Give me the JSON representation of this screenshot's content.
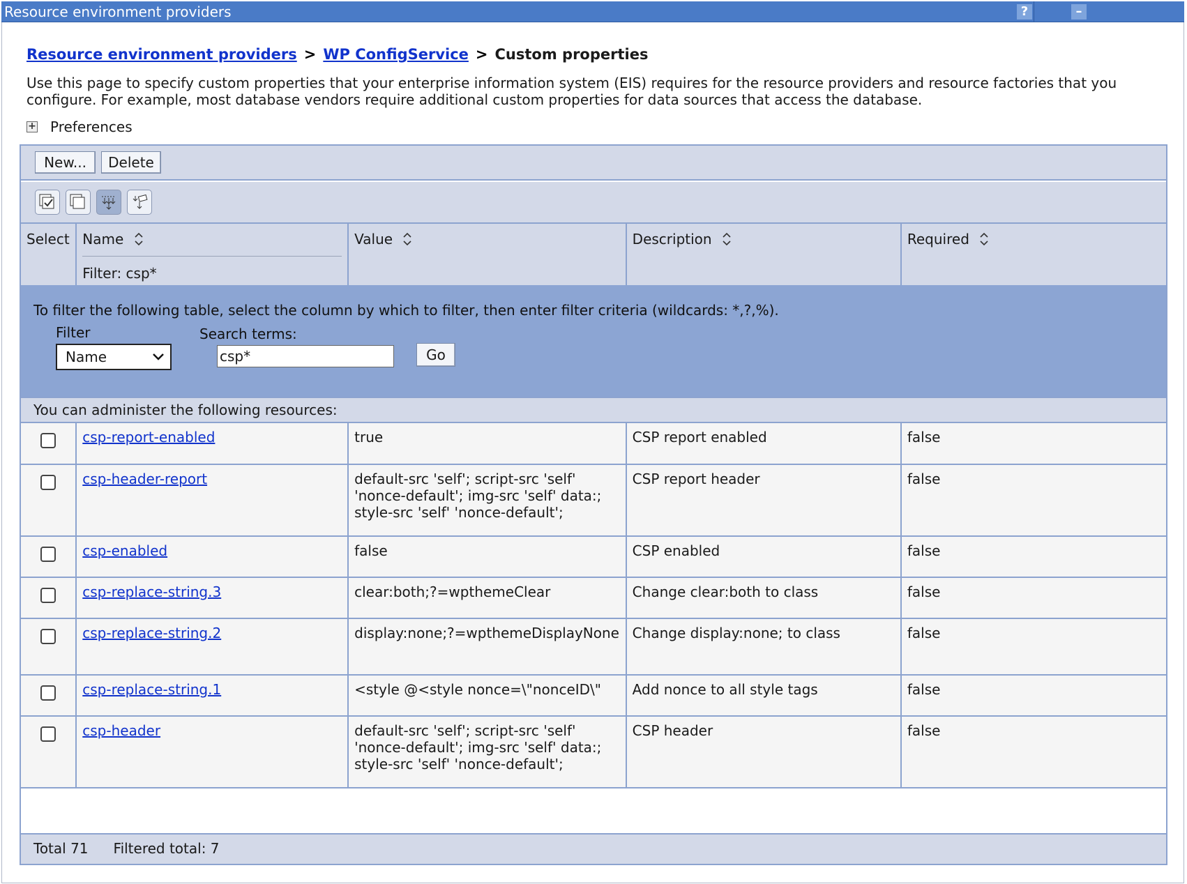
{
  "window": {
    "title": "Resource environment providers",
    "help_icon": "question-icon",
    "minimize_icon": "minimize-icon"
  },
  "breadcrumb": {
    "link1": "Resource environment providers",
    "separator": ">",
    "link2": "WP ConfigService",
    "current": "Custom properties"
  },
  "description": "Use this page to specify custom properties that your enterprise information system (EIS) requires for the resource providers and resource factories that you configure. For example, most database vendors require additional custom properties for data sources that access the database.",
  "preferences": {
    "label": "Preferences",
    "icon": "expand-plus-icon"
  },
  "toolbar": {
    "new_label": "New...",
    "delete_label": "Delete",
    "icons": [
      "select-all-icon",
      "deselect-all-icon",
      "show-filter-icon",
      "clear-filter-icon"
    ]
  },
  "table": {
    "columns": {
      "select": "Select",
      "name": "Name",
      "value": "Value",
      "description": "Description",
      "required": "Required"
    },
    "active_filter": "Filter: csp*",
    "rows": [
      {
        "name": "csp-report-enabled",
        "value": "true",
        "description": "CSP report enabled",
        "required": "false"
      },
      {
        "name": "csp-header-report",
        "value": "default-src 'self'; script-src 'self' 'nonce-default'; img-src 'self' data:; style-src 'self' 'nonce-default';",
        "description": "CSP report header",
        "required": "false"
      },
      {
        "name": "csp-enabled",
        "value": "false",
        "description": "CSP enabled",
        "required": "false"
      },
      {
        "name": "csp-replace-string.3",
        "value": "clear:both;?=wpthemeClear",
        "description": "Change clear:both to class",
        "required": "false"
      },
      {
        "name": "csp-replace-string.2",
        "value": "display:none;?=wpthemeDisplayNone",
        "description": "Change display:none; to class",
        "required": "false"
      },
      {
        "name": "csp-replace-string.1",
        "value": "<style @<style nonce=\\\"nonceID\\\"",
        "description": "Add nonce to all style tags",
        "required": "false"
      },
      {
        "name": "csp-header",
        "value": "default-src 'self'; script-src 'self' 'nonce-default'; img-src 'self' data:; style-src 'self' 'nonce-default';",
        "description": "CSP header",
        "required": "false"
      }
    ]
  },
  "filter_panel": {
    "instructions": "To filter the following table, select the column by which to filter, then enter filter criteria (wildcards: *,?,%).",
    "filter_label": "Filter",
    "filter_selected": "Name",
    "search_label": "Search terms:",
    "search_value": "csp*",
    "go_label": "Go"
  },
  "admin_text": "You can administer the following resources:",
  "footer": {
    "total": "Total 71",
    "filtered_total": "Filtered total: 7"
  },
  "colors": {
    "titlebar": "#4a7bc7",
    "header_bg": "#d3d9e8",
    "filter_bg": "#8ca5d3",
    "border": "#8ca3cf",
    "link": "#1133cc"
  }
}
